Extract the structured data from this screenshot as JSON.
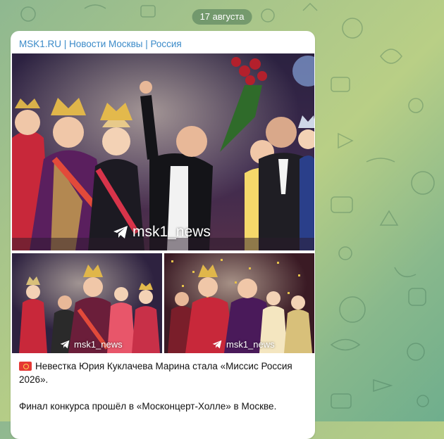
{
  "date_separator": "17 августа",
  "post": {
    "sender": "MSK1.RU | Новости Москвы | Россия",
    "watermark": "msk1_news",
    "caption_line1": "Невестка Юрия Куклачева Марина стала «Миссис Россия 2026».",
    "caption_line2": "Финал конкурса прошёл в «Москонцерт-Холле» в Москве."
  },
  "colors": {
    "sender_link": "#3a8ac8",
    "bubble": "#ffffff",
    "date_pill": "#4a7656"
  },
  "icons": {
    "watermark": "telegram-plane-icon",
    "flag": "red-flag-emoji"
  }
}
